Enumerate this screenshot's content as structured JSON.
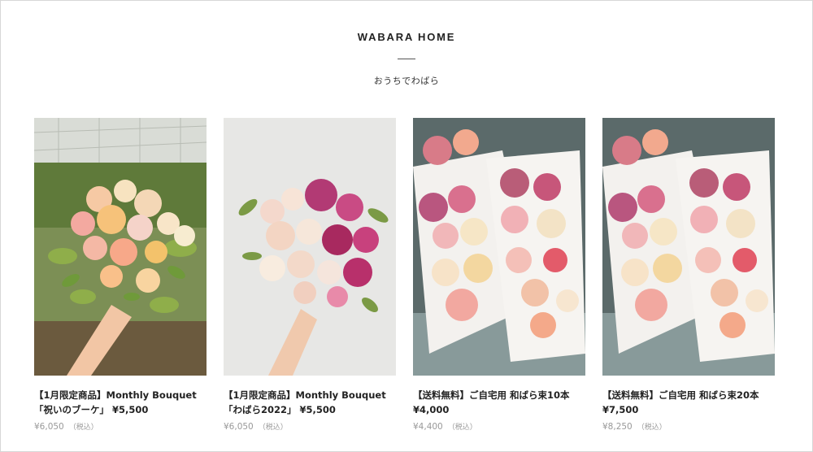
{
  "site": {
    "brand": "WABARA HOME",
    "tagline": "おうちでわばら"
  },
  "products": [
    {
      "title": "【1月限定商品】Monthly Bouquet 「祝いのブーケ」",
      "price": "¥5,500",
      "original_price": "¥6,050",
      "tax_note": "（税込）",
      "image_icon": "bouquet-in-greenhouse"
    },
    {
      "title": "【1月限定商品】Monthly Bouquet 「わばら2022」",
      "price": "¥5,500",
      "original_price": "¥6,050",
      "tax_note": "（税込）",
      "image_icon": "bouquet-white-background"
    },
    {
      "title": "【送料無料】ご自宅用 和ばら束10本",
      "price": "¥4,000",
      "original_price": "¥4,400",
      "tax_note": "（税込）",
      "image_icon": "wrapped-rose-bundles"
    },
    {
      "title": "【送料無料】ご自宅用 和ばら束20本",
      "price": "¥7,500",
      "original_price": "¥8,250",
      "tax_note": "（税込）",
      "image_icon": "wrapped-rose-bundles"
    }
  ],
  "colors": {
    "text": "#222222",
    "muted": "#999999",
    "border": "#d7d7d7"
  }
}
